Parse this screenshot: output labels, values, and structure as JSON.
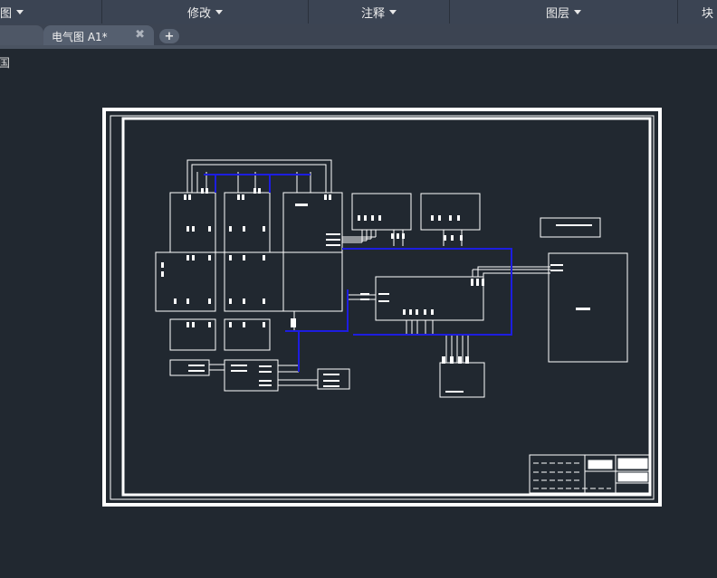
{
  "ribbon": {
    "panels": [
      {
        "label": "图",
        "arrow": true
      },
      {
        "label": "修改",
        "arrow": true
      },
      {
        "label": "注释",
        "arrow": true
      },
      {
        "label": "图层",
        "arrow": true
      },
      {
        "label": "块",
        "arrow": false
      }
    ]
  },
  "tabs": {
    "active_label": "电气图 A1*",
    "close_glyph": "✖",
    "add_glyph": "+"
  },
  "viewport": {
    "label": "国"
  },
  "colors": {
    "background": "#212830",
    "linework": "#ffffff",
    "wire_blue": "#1d1de0",
    "ribbon": "#3b4453"
  }
}
